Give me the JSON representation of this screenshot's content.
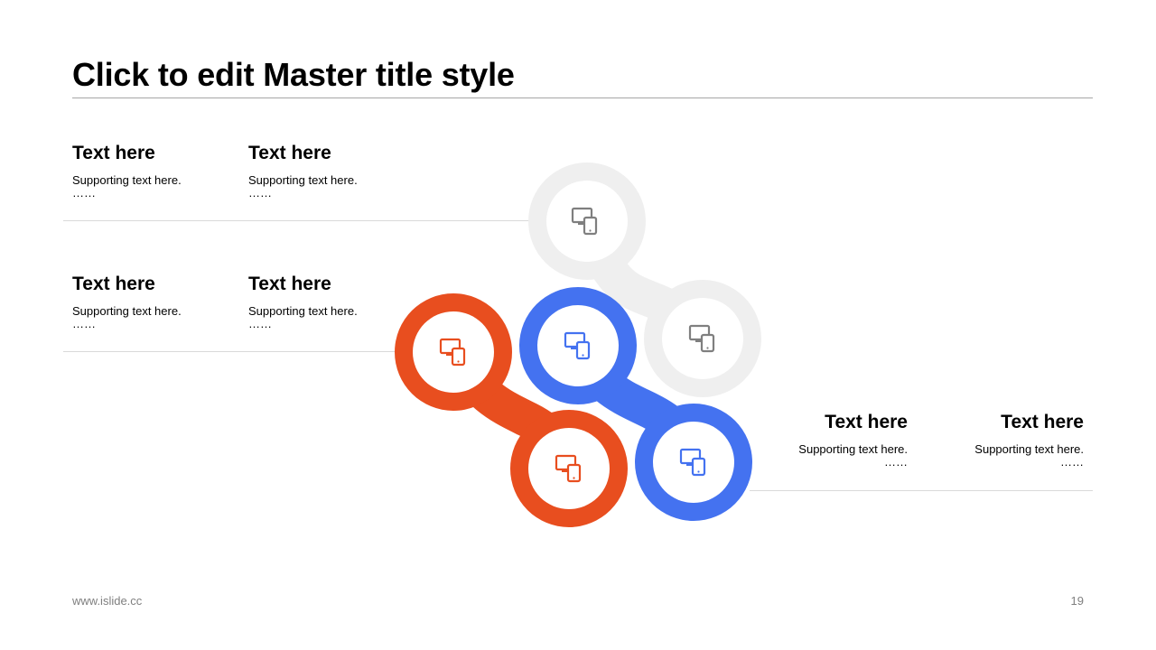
{
  "title": "Click to edit Master title style",
  "blocks": [
    {
      "heading": "Text here",
      "support": "Supporting text here.",
      "dots": "……"
    },
    {
      "heading": "Text here",
      "support": "Supporting text here.",
      "dots": "……"
    },
    {
      "heading": "Text here",
      "support": "Supporting text here.",
      "dots": "……"
    },
    {
      "heading": "Text here",
      "support": "Supporting text here.",
      "dots": "……"
    },
    {
      "heading": "Text here",
      "support": "Supporting text here.",
      "dots": "……"
    },
    {
      "heading": "Text here",
      "support": "Supporting text here.",
      "dots": "……"
    }
  ],
  "diagram": {
    "colors": {
      "gray": "#efefef",
      "orange": "#e84e1f",
      "blue": "#4472f0",
      "gray_icon": "#7f7f7f"
    },
    "icons": "devices-icon"
  },
  "footer": {
    "url": "www.islide.cc",
    "page": "19"
  }
}
